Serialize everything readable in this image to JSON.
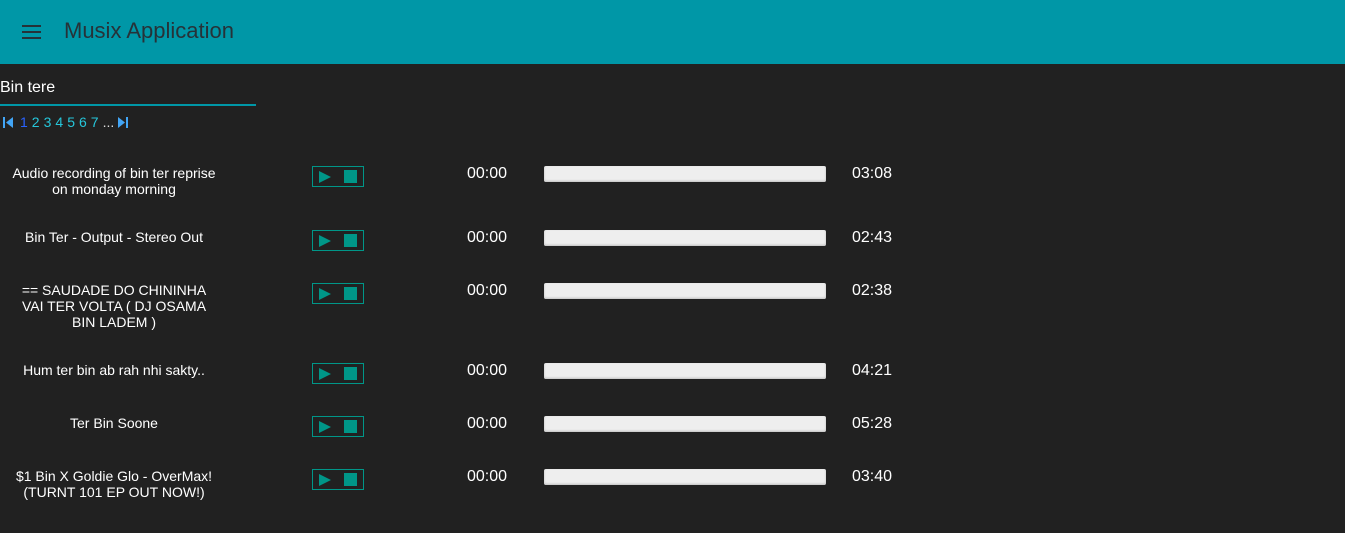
{
  "header": {
    "title": "Musix Application",
    "menu_icon": "hamburger-menu-icon",
    "background": "#0097a7"
  },
  "search": {
    "value": "Bin tere",
    "placeholder": ""
  },
  "pagination": {
    "first_icon": "first-page-icon",
    "last_icon": "last-page-icon",
    "pages": [
      "1",
      "2",
      "3",
      "4",
      "5",
      "6",
      "7"
    ],
    "current": "1",
    "ellipsis": "..."
  },
  "tracks": [
    {
      "title": "Audio recording of bin ter reprise on monday morning",
      "current_time": "00:00",
      "duration": "03:08",
      "progress": 0
    },
    {
      "title": "Bin Ter - Output - Stereo Out",
      "current_time": "00:00",
      "duration": "02:43",
      "progress": 0
    },
    {
      "title": "== SAUDADE DO CHININHA VAI TER VOLTA ( DJ OSAMA BIN LADEM )",
      "current_time": "00:00",
      "duration": "02:38",
      "progress": 0
    },
    {
      "title": "Hum ter bin ab rah nhi sakty..",
      "current_time": "00:00",
      "duration": "04:21",
      "progress": 0
    },
    {
      "title": "Ter Bin Soone",
      "current_time": "00:00",
      "duration": "05:28",
      "progress": 0
    },
    {
      "title": "$1 Bin X Goldie Glo - OverMax! (TURNT 101 EP OUT NOW!)",
      "current_time": "00:00",
      "duration": "03:40",
      "progress": 0
    }
  ],
  "colors": {
    "accent": "#009688",
    "page_link": "#26c6da",
    "page_current": "#2962ff",
    "background": "#212121"
  }
}
